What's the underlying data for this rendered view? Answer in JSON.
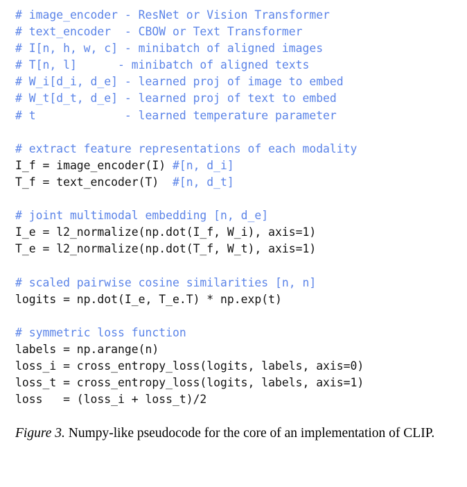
{
  "figure": {
    "background_color": "#ffffff",
    "code_color": "#111111",
    "comment_color": "#5b84e8"
  },
  "code": {
    "language": "python-pseudocode",
    "lines": [
      {
        "segments": [
          {
            "type": "comment",
            "text": "# image_encoder - ResNet or Vision Transformer"
          }
        ]
      },
      {
        "segments": [
          {
            "type": "comment",
            "text": "# text_encoder  - CBOW or Text Transformer"
          }
        ]
      },
      {
        "segments": [
          {
            "type": "comment",
            "text": "# I[n, h, w, c] - minibatch of aligned images"
          }
        ]
      },
      {
        "segments": [
          {
            "type": "comment",
            "text": "# T[n, l]      - minibatch of aligned texts"
          }
        ]
      },
      {
        "segments": [
          {
            "type": "comment",
            "text": "# W_i[d_i, d_e] - learned proj of image to embed"
          }
        ]
      },
      {
        "segments": [
          {
            "type": "comment",
            "text": "# W_t[d_t, d_e] - learned proj of text to embed"
          }
        ]
      },
      {
        "segments": [
          {
            "type": "comment",
            "text": "# t             - learned temperature parameter"
          }
        ]
      },
      {
        "segments": []
      },
      {
        "segments": [
          {
            "type": "comment",
            "text": "# extract feature representations of each modality"
          }
        ]
      },
      {
        "segments": [
          {
            "type": "code",
            "text": "I_f = image_encoder(I) "
          },
          {
            "type": "comment",
            "text": "#[n, d_i]"
          }
        ]
      },
      {
        "segments": [
          {
            "type": "code",
            "text": "T_f = text_encoder(T)  "
          },
          {
            "type": "comment",
            "text": "#[n, d_t]"
          }
        ]
      },
      {
        "segments": []
      },
      {
        "segments": [
          {
            "type": "comment",
            "text": "# joint multimodal embedding [n, d_e]"
          }
        ]
      },
      {
        "segments": [
          {
            "type": "code",
            "text": "I_e = l2_normalize(np.dot(I_f, W_i), axis=1)"
          }
        ]
      },
      {
        "segments": [
          {
            "type": "code",
            "text": "T_e = l2_normalize(np.dot(T_f, W_t), axis=1)"
          }
        ]
      },
      {
        "segments": []
      },
      {
        "segments": [
          {
            "type": "comment",
            "text": "# scaled pairwise cosine similarities [n, n]"
          }
        ]
      },
      {
        "segments": [
          {
            "type": "code",
            "text": "logits = np.dot(I_e, T_e.T) * np.exp(t)"
          }
        ]
      },
      {
        "segments": []
      },
      {
        "segments": [
          {
            "type": "comment",
            "text": "# symmetric loss function"
          }
        ]
      },
      {
        "segments": [
          {
            "type": "code",
            "text": "labels = np.arange(n)"
          }
        ]
      },
      {
        "segments": [
          {
            "type": "code",
            "text": "loss_i = cross_entropy_loss(logits, labels, axis=0)"
          }
        ]
      },
      {
        "segments": [
          {
            "type": "code",
            "text": "loss_t = cross_entropy_loss(logits, labels, axis=1)"
          }
        ]
      },
      {
        "segments": [
          {
            "type": "code",
            "text": "loss   = (loss_i + loss_t)/2"
          }
        ]
      }
    ]
  },
  "caption": {
    "label": "Figure 3.",
    "body": " Numpy-like pseudocode for the core of an implementation of CLIP."
  }
}
